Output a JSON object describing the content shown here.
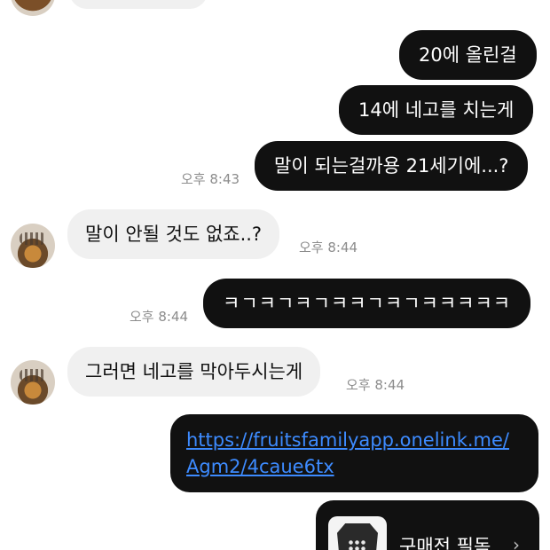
{
  "messages": {
    "m1": "20에 올린걸",
    "m2": "14에 네고를 치는게",
    "m3": "말이 되는걸까용 21세기에...?",
    "m4": "말이 안될 것도 없죠..?",
    "m5": "ㅋㄱㅋㄱㅋㄱㅋㅋㄱㅋㄱㅋㅋㅋㅋㅋ",
    "m6": "그러면 네고를 막아두시는게"
  },
  "timestamps": {
    "t3": "오후 8:43",
    "t4": "오후 8:44",
    "t5": "오후 8:44",
    "t6": "오후 8:44"
  },
  "link": {
    "line1": "https://fruitsfamilyapp.onelink.me/",
    "line2": "Agm2/4caue6tx"
  },
  "product_card": {
    "title": "구매전 필독",
    "chevron": "›"
  },
  "colors": {
    "outgoing_bubble": "#111111",
    "incoming_bubble": "#f0f0f0",
    "link": "#3d8bff",
    "timestamp": "#8c8c8c"
  }
}
